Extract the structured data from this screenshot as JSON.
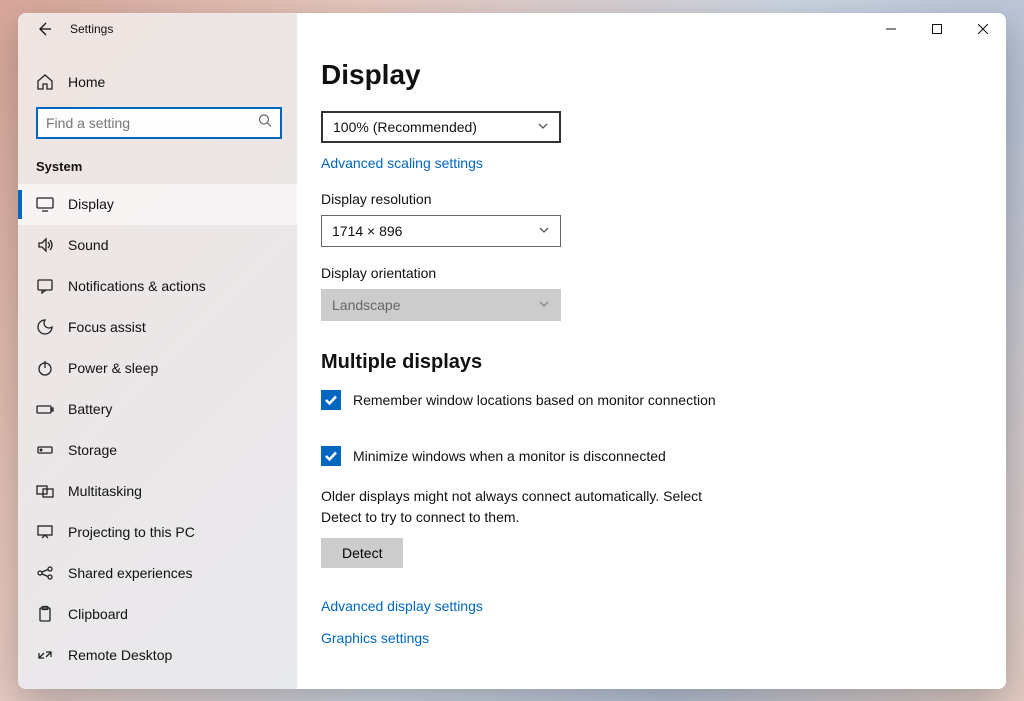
{
  "window": {
    "title": "Settings"
  },
  "sidebar": {
    "home": "Home",
    "search_placeholder": "Find a setting",
    "section": "System",
    "items": [
      {
        "label": "Display"
      },
      {
        "label": "Sound"
      },
      {
        "label": "Notifications & actions"
      },
      {
        "label": "Focus assist"
      },
      {
        "label": "Power & sleep"
      },
      {
        "label": "Battery"
      },
      {
        "label": "Storage"
      },
      {
        "label": "Multitasking"
      },
      {
        "label": "Projecting to this PC"
      },
      {
        "label": "Shared experiences"
      },
      {
        "label": "Clipboard"
      },
      {
        "label": "Remote Desktop"
      }
    ]
  },
  "main": {
    "title": "Display",
    "scale": {
      "value": "100% (Recommended)"
    },
    "scale_link": "Advanced scaling settings",
    "resolution": {
      "label": "Display resolution",
      "value": "1714 × 896"
    },
    "orientation": {
      "label": "Display orientation",
      "value": "Landscape"
    },
    "multi": {
      "heading": "Multiple displays",
      "check1": "Remember window locations based on monitor connection",
      "check2": "Minimize windows when a monitor is disconnected",
      "hint": "Older displays might not always connect automatically. Select Detect to try to connect to them.",
      "detect": "Detect"
    },
    "adv_link": "Advanced display settings",
    "gfx_link": "Graphics settings"
  }
}
